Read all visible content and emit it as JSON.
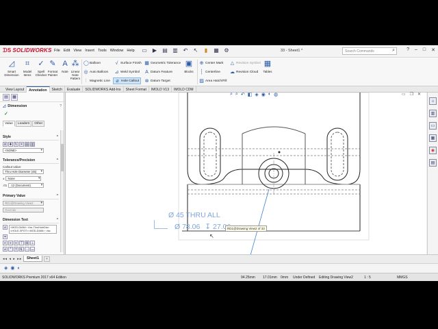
{
  "app": {
    "logo_text": "SOLIDWORKS",
    "menu": [
      "File",
      "Edit",
      "View",
      "Insert",
      "Tools",
      "Window",
      "Help"
    ],
    "doc_title": "33 - Sheet1 *",
    "search_placeholder": "Search Commands",
    "window_controls": [
      "?",
      "–",
      "□",
      "✕"
    ]
  },
  "ribbon": {
    "big_buttons": [
      {
        "label": "Smart Dimension",
        "icon": "smart-dimension-icon",
        "glyph": "◿"
      },
      {
        "label": "Model Items",
        "icon": "model-items-icon",
        "glyph": "⌗"
      },
      {
        "label": "Spell Checker",
        "icon": "spell-checker-icon",
        "glyph": "✓"
      },
      {
        "label": "Format Painter",
        "icon": "format-painter-icon",
        "glyph": "✎"
      },
      {
        "label": "Note",
        "icon": "note-icon",
        "glyph": "A"
      },
      {
        "label": "Linear Note Pattern",
        "icon": "linear-note-pattern-icon",
        "glyph": "⁂"
      }
    ],
    "col1": [
      "Balloon",
      "Auto Balloon",
      "Magnetic Line"
    ],
    "col2": [
      "Surface Finish",
      "Weld Symbol",
      "Hole Callout"
    ],
    "col3": [
      "Geometric Tolerance",
      "Datum Feature",
      "Datum Target"
    ],
    "col4": [
      "Blocks"
    ],
    "col5": [
      "Center Mark",
      "Centerline",
      "Area Hatch/Fill"
    ],
    "col6": [
      "Revision Symbol",
      "Revision Cloud"
    ],
    "col7": [
      "Tables"
    ]
  },
  "command_tabs": [
    "View Layout",
    "Annotation",
    "Sketch",
    "Evaluate",
    "SOLIDWORKS Add-Ins",
    "Sheet Format",
    "IMOLD V13",
    "IMOLD CDM"
  ],
  "active_tab": "Annotation",
  "property_manager": {
    "title": "Dimension",
    "help": "?",
    "tabs": [
      "Value",
      "Leaders",
      "Other"
    ],
    "style_header": "Style",
    "style_value": "<NONE>",
    "tolerance_header": "Tolerance/Precision",
    "callout_label": "Callout value:",
    "callout_value": "Thru Hole Diameter (45)",
    "tolerance_type": "None",
    "precision": ".12 (Document)",
    "primary_header": "Primary Value",
    "primary_ref": "RD1@Drawing View2",
    "primary_override": "Override",
    "text_header": "Dimension Text",
    "text_lines": [
      "<MOD-DIAM> <hw-ThruHoleDia>",
      "<HOLE-SPOT><MOD-DIAM> <hw"
    ]
  },
  "drawing": {
    "callout_line1": "Ø 45 THRU ALL",
    "callout_line2_diam": "Ø 78.06",
    "callout_line2_depth": "27.06",
    "tooltip": "RD1@Drawing View2 of 33"
  },
  "sheet_tabs": {
    "nav": "◂◂ ◂ ▸ ▸▸",
    "active": "Sheet1",
    "add": "+"
  },
  "status": {
    "edition": "SOLIDWORKS Premium 2017 x64 Edition",
    "x": "94.25mm",
    "y": "17.01mm",
    "z": "0mm",
    "state": "Under Defined",
    "editing": "Editing Drawing View2",
    "scale": "1 : 5",
    "units": "MMGS"
  }
}
